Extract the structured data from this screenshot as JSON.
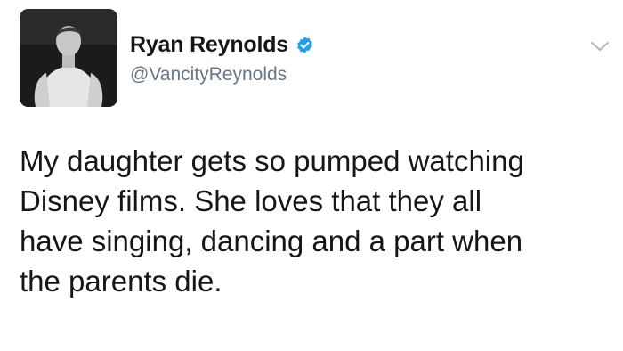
{
  "tweet": {
    "author": {
      "display_name": "Ryan Reynolds",
      "handle": "@VancityReynolds",
      "verified": true,
      "avatar_icon": "profile-photo",
      "verified_icon": "verified-badge-icon"
    },
    "text": "My daughter gets so pumped watching\nDisney films. She loves that they all\nhave singing, dancing and a part when\nthe parents die.",
    "menu_icon": "chevron-down-icon"
  },
  "colors": {
    "text": "#14171a",
    "secondary": "#657786",
    "verified": "#1da1f2",
    "chevron": "#aab8c2"
  }
}
